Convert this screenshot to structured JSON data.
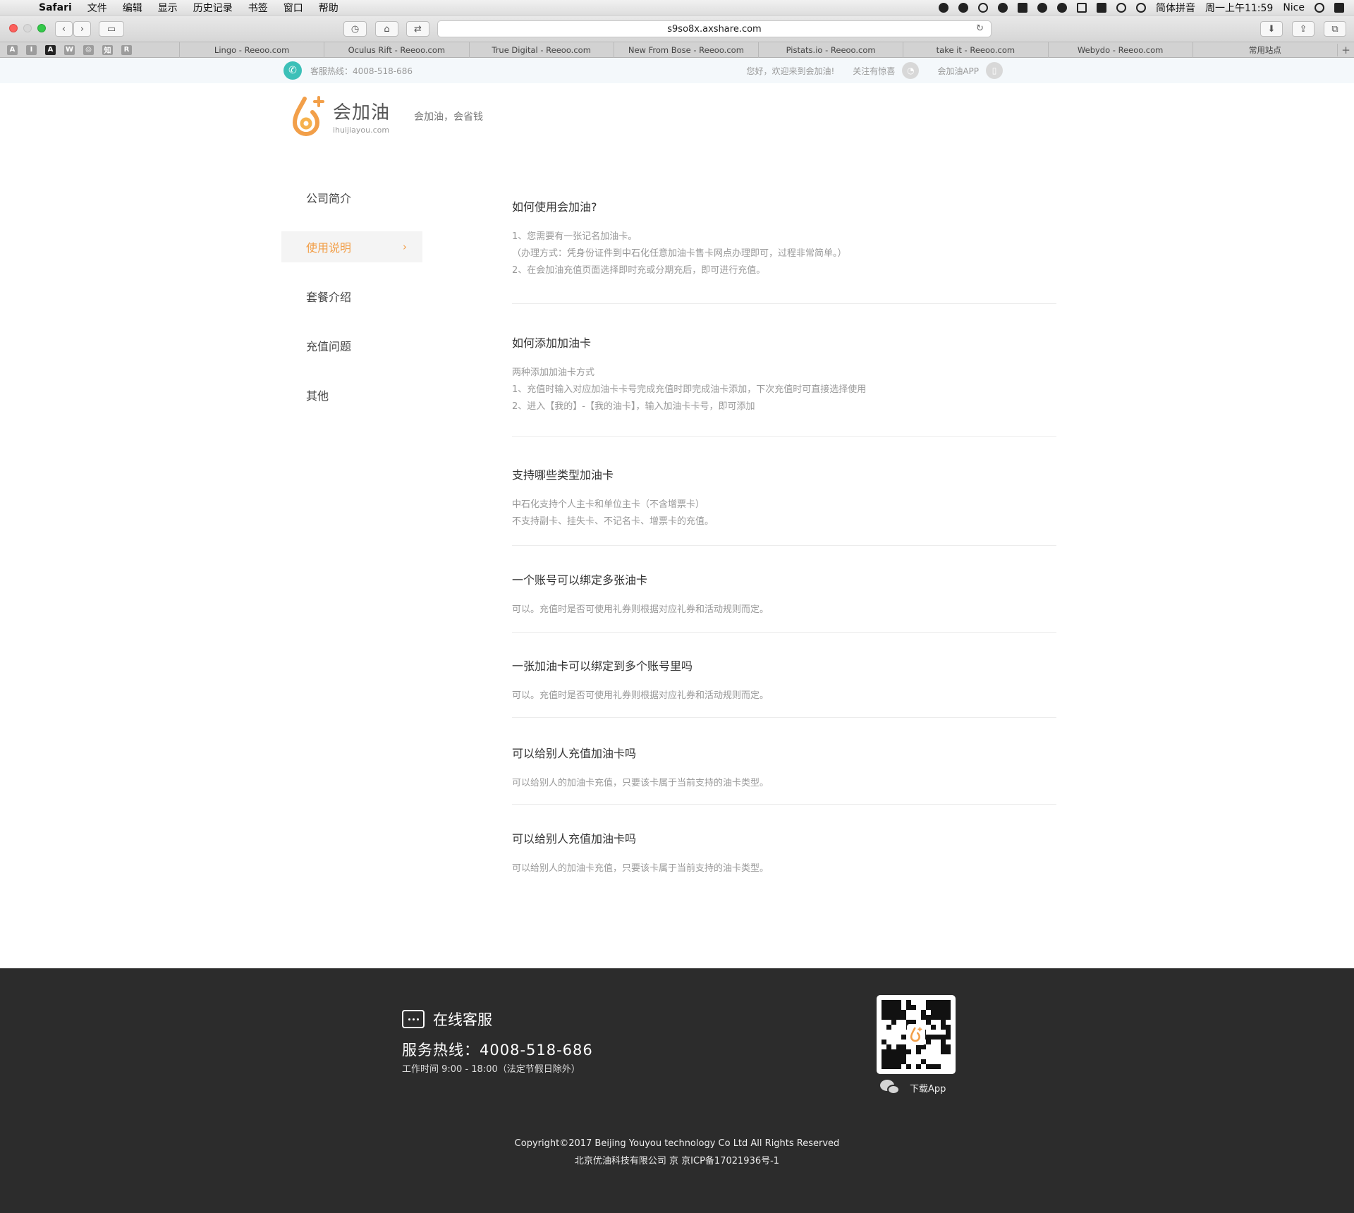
{
  "menubar": {
    "app_name": "Safari",
    "menus": [
      "文件",
      "编辑",
      "显示",
      "历史记录",
      "书签",
      "窗口",
      "帮助"
    ],
    "input_method": "简体拼音",
    "clock": "周一上午11:59",
    "user": "Nice"
  },
  "browser": {
    "url": "s9so8x.axshare.com",
    "favorites": [
      "A",
      "I",
      "A",
      "W",
      "◎",
      "知",
      "R"
    ],
    "tabs": [
      "Lingo - Reeoo.com",
      "Oculus Rift - Reeoo.com",
      "True Digital - Reeoo.com",
      "New From Bose - Reeoo.com",
      "Pistats.io - Reeoo.com",
      "take it - Reeoo.com",
      "Webydo - Reeoo.com",
      "常用站点"
    ]
  },
  "topstrip": {
    "hotline": "客服热线：4008-518-686",
    "welcome": "您好，欢迎来到会加油!",
    "follow": "关注有惊喜",
    "app": "会加油APP"
  },
  "header": {
    "logo_name": "会加油",
    "logo_domain": "ihuijiayou.com",
    "slogan": "会加油，会省钱"
  },
  "sidebar": {
    "items": [
      {
        "label": "公司简介",
        "active": false
      },
      {
        "label": "使用说明",
        "active": true
      },
      {
        "label": "套餐介绍",
        "active": false
      },
      {
        "label": "充值问题",
        "active": false
      },
      {
        "label": "其他",
        "active": false
      }
    ],
    "chevron": "›"
  },
  "faq": [
    {
      "title": "如何使用会加油?",
      "lines": [
        "1、您需要有一张记名加油卡。",
        "（办理方式：凭身份证件到中石化任意加油卡售卡网点办理即可，过程非常简单。）",
        "2、在会加油充值页面选择即时充或分期充后，即可进行充值。"
      ]
    },
    {
      "title": "如何添加加油卡",
      "lines": [
        "两种添加加油卡方式",
        "1、充值时输入对应加油卡卡号完成充值时即完成油卡添加，下次充值时可直接选择使用",
        "2、进入【我的】-【我的油卡】，输入加油卡卡号，即可添加"
      ]
    },
    {
      "title": "支持哪些类型加油卡",
      "lines": [
        "中石化支持个人主卡和单位主卡（不含增票卡）",
        "不支持副卡、挂失卡、不记名卡、增票卡的充值。"
      ]
    },
    {
      "title": "一个账号可以绑定多张油卡",
      "lines": [
        "可以。充值时是否可使用礼券则根据对应礼券和活动规则而定。"
      ]
    },
    {
      "title": "一张加油卡可以绑定到多个账号里吗",
      "lines": [
        "可以。充值时是否可使用礼券则根据对应礼券和活动规则而定。"
      ]
    },
    {
      "title": "可以给别人充值加油卡吗",
      "lines": [
        "可以给别人的加油卡充值，只要该卡属于当前支持的油卡类型。"
      ]
    },
    {
      "title": "可以给别人充值加油卡吗",
      "lines": [
        "可以给别人的加油卡充值，只要该卡属于当前支持的油卡类型。"
      ]
    }
  ],
  "footer": {
    "service_title": "在线客服",
    "hotline": "服务热线：4008-518-686",
    "hours": "工作时间 9:00 - 18:00（法定节假日除外）",
    "download": "下载App",
    "copyright": "Copyright©2017 Beijing  Youyou technology Co Ltd All Rights Reserved",
    "icp": "北京优油科技有限公司 京 京ICP备17021936号-1"
  },
  "colors": {
    "accent": "#f29f49",
    "phone_icon": "#3cc0b8",
    "footer_bg": "#2c2c2c",
    "topstrip_bg": "#f4f8fb"
  }
}
